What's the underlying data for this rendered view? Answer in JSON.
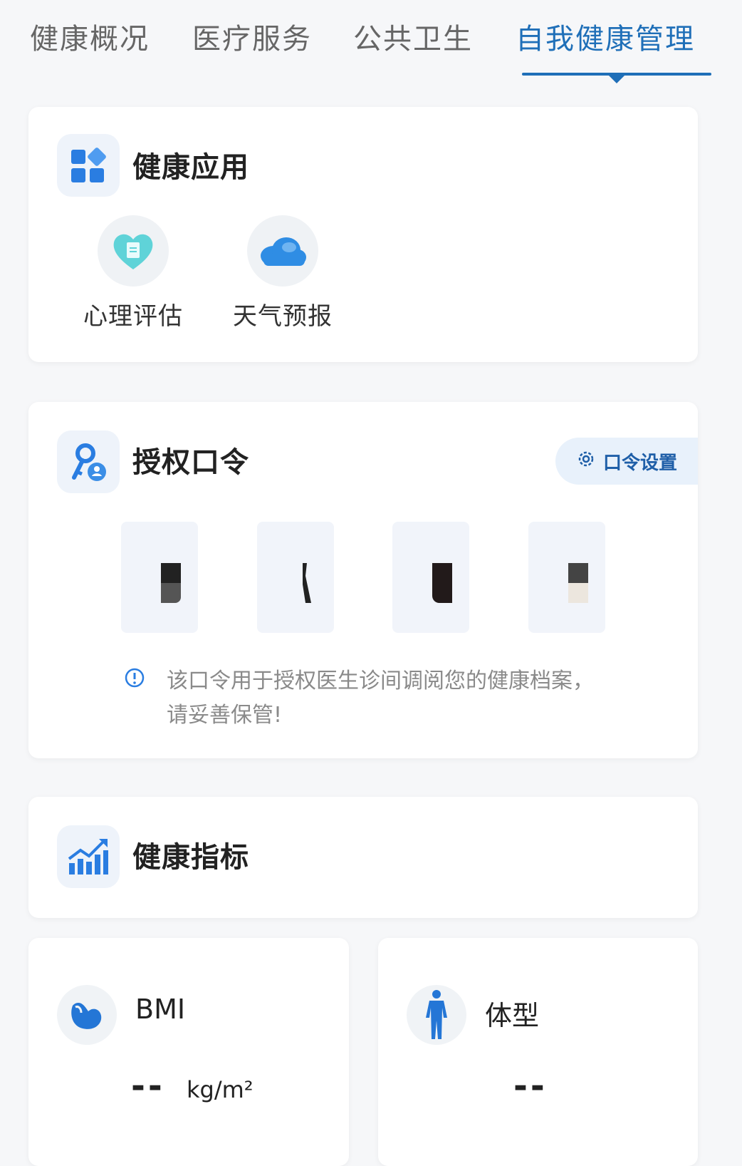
{
  "tabs": [
    {
      "label": "健康概况"
    },
    {
      "label": "医疗服务"
    },
    {
      "label": "公共卫生"
    },
    {
      "label": "自我健康管理"
    }
  ],
  "health_apps": {
    "title": "健康应用",
    "items": [
      {
        "label": "心理评估",
        "icon": "heart-document-icon"
      },
      {
        "label": "天气预报",
        "icon": "cloud-icon"
      }
    ]
  },
  "auth_code": {
    "title": "授权口令",
    "settings_button": "口令设置",
    "note": "该口令用于授权医生诊间调阅您的健康档案，请妥善保管!"
  },
  "health_indicators": {
    "title": "健康指标"
  },
  "metrics": [
    {
      "label": "BMI",
      "value": "--",
      "unit": "kg/m²",
      "icon": "muscle-arm-icon"
    },
    {
      "label": "体型",
      "value": "--",
      "icon": "body-figure-icon"
    }
  ],
  "colors": {
    "accent": "#1f6fb8",
    "background": "#f6f7f9"
  }
}
